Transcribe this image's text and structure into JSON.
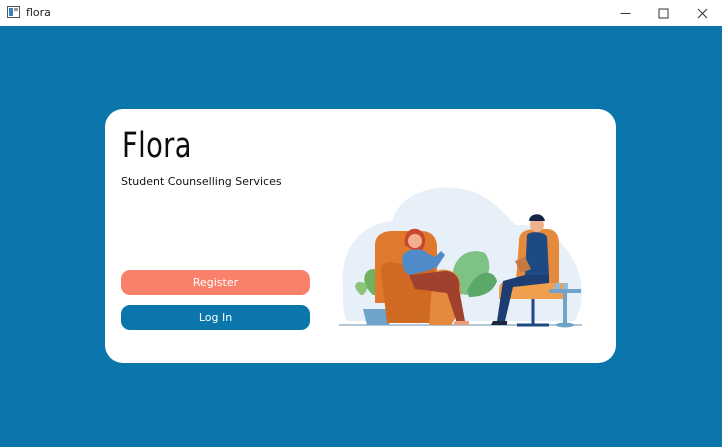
{
  "window": {
    "title": "flora",
    "icons": {
      "app": "app-window-icon",
      "minimize": "minimize-icon",
      "maximize": "maximize-icon",
      "close": "close-icon"
    }
  },
  "card": {
    "brand": "Flora",
    "tagline": "Student Counselling Services",
    "register_label": "Register",
    "login_label": "Log In",
    "illustration": "counselling-session-illustration"
  },
  "colors": {
    "background": "#0b76ab",
    "card": "#ffffff",
    "register_button": "#f9806a",
    "login_button": "#0b76ab"
  }
}
